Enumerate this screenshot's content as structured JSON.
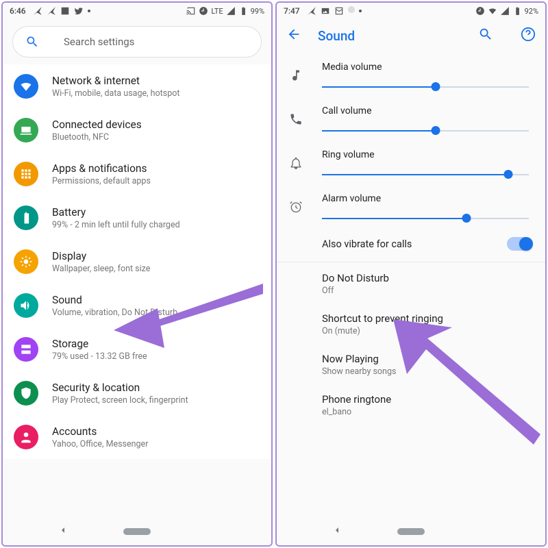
{
  "left": {
    "status": {
      "time": "6:46",
      "net": "LTE",
      "batt": "99%"
    },
    "search": {
      "placeholder": "Search settings"
    },
    "items": [
      {
        "label": "Network & internet",
        "sub": "Wi-Fi, mobile, data usage, hotspot",
        "color": "c-blue",
        "icon": "wifi"
      },
      {
        "label": "Connected devices",
        "sub": "Bluetooth, NFC",
        "color": "c-green",
        "icon": "devices"
      },
      {
        "label": "Apps & notifications",
        "sub": "Permissions, default apps",
        "color": "c-orange",
        "icon": "apps"
      },
      {
        "label": "Battery",
        "sub": "99% - 2 min left until fully charged",
        "color": "c-teal",
        "icon": "battery"
      },
      {
        "label": "Display",
        "sub": "Wallpaper, sleep, font size",
        "color": "c-dorange",
        "icon": "brightness"
      },
      {
        "label": "Sound",
        "sub": "Volume, vibration, Do Not Disturb",
        "color": "c-tealdk",
        "icon": "volume"
      },
      {
        "label": "Storage",
        "sub": "79% used - 13.32 GB free",
        "color": "c-purple",
        "icon": "storage"
      },
      {
        "label": "Security & location",
        "sub": "Play Protect, screen lock, fingerprint",
        "color": "c-greendk",
        "icon": "security"
      },
      {
        "label": "Accounts",
        "sub": "Yahoo, Office, Messenger",
        "color": "c-pink",
        "icon": "account"
      }
    ]
  },
  "right": {
    "status": {
      "time": "7:47",
      "batt": "92%"
    },
    "header": {
      "title": "Sound"
    },
    "sliders": [
      {
        "label": "Media volume",
        "icon": "music",
        "percent": 55
      },
      {
        "label": "Call volume",
        "icon": "phone",
        "percent": 55
      },
      {
        "label": "Ring volume",
        "icon": "bell",
        "percent": 90
      },
      {
        "label": "Alarm volume",
        "icon": "alarm",
        "percent": 70
      }
    ],
    "vibrate": {
      "label": "Also vibrate for calls",
      "on": true
    },
    "rows": [
      {
        "label": "Do Not Disturb",
        "sub": "Off"
      },
      {
        "label": "Shortcut to prevent ringing",
        "sub": "On (mute)"
      },
      {
        "label": "Now Playing",
        "sub": "Show nearby songs"
      },
      {
        "label": "Phone ringtone",
        "sub": "el_bano"
      }
    ]
  }
}
